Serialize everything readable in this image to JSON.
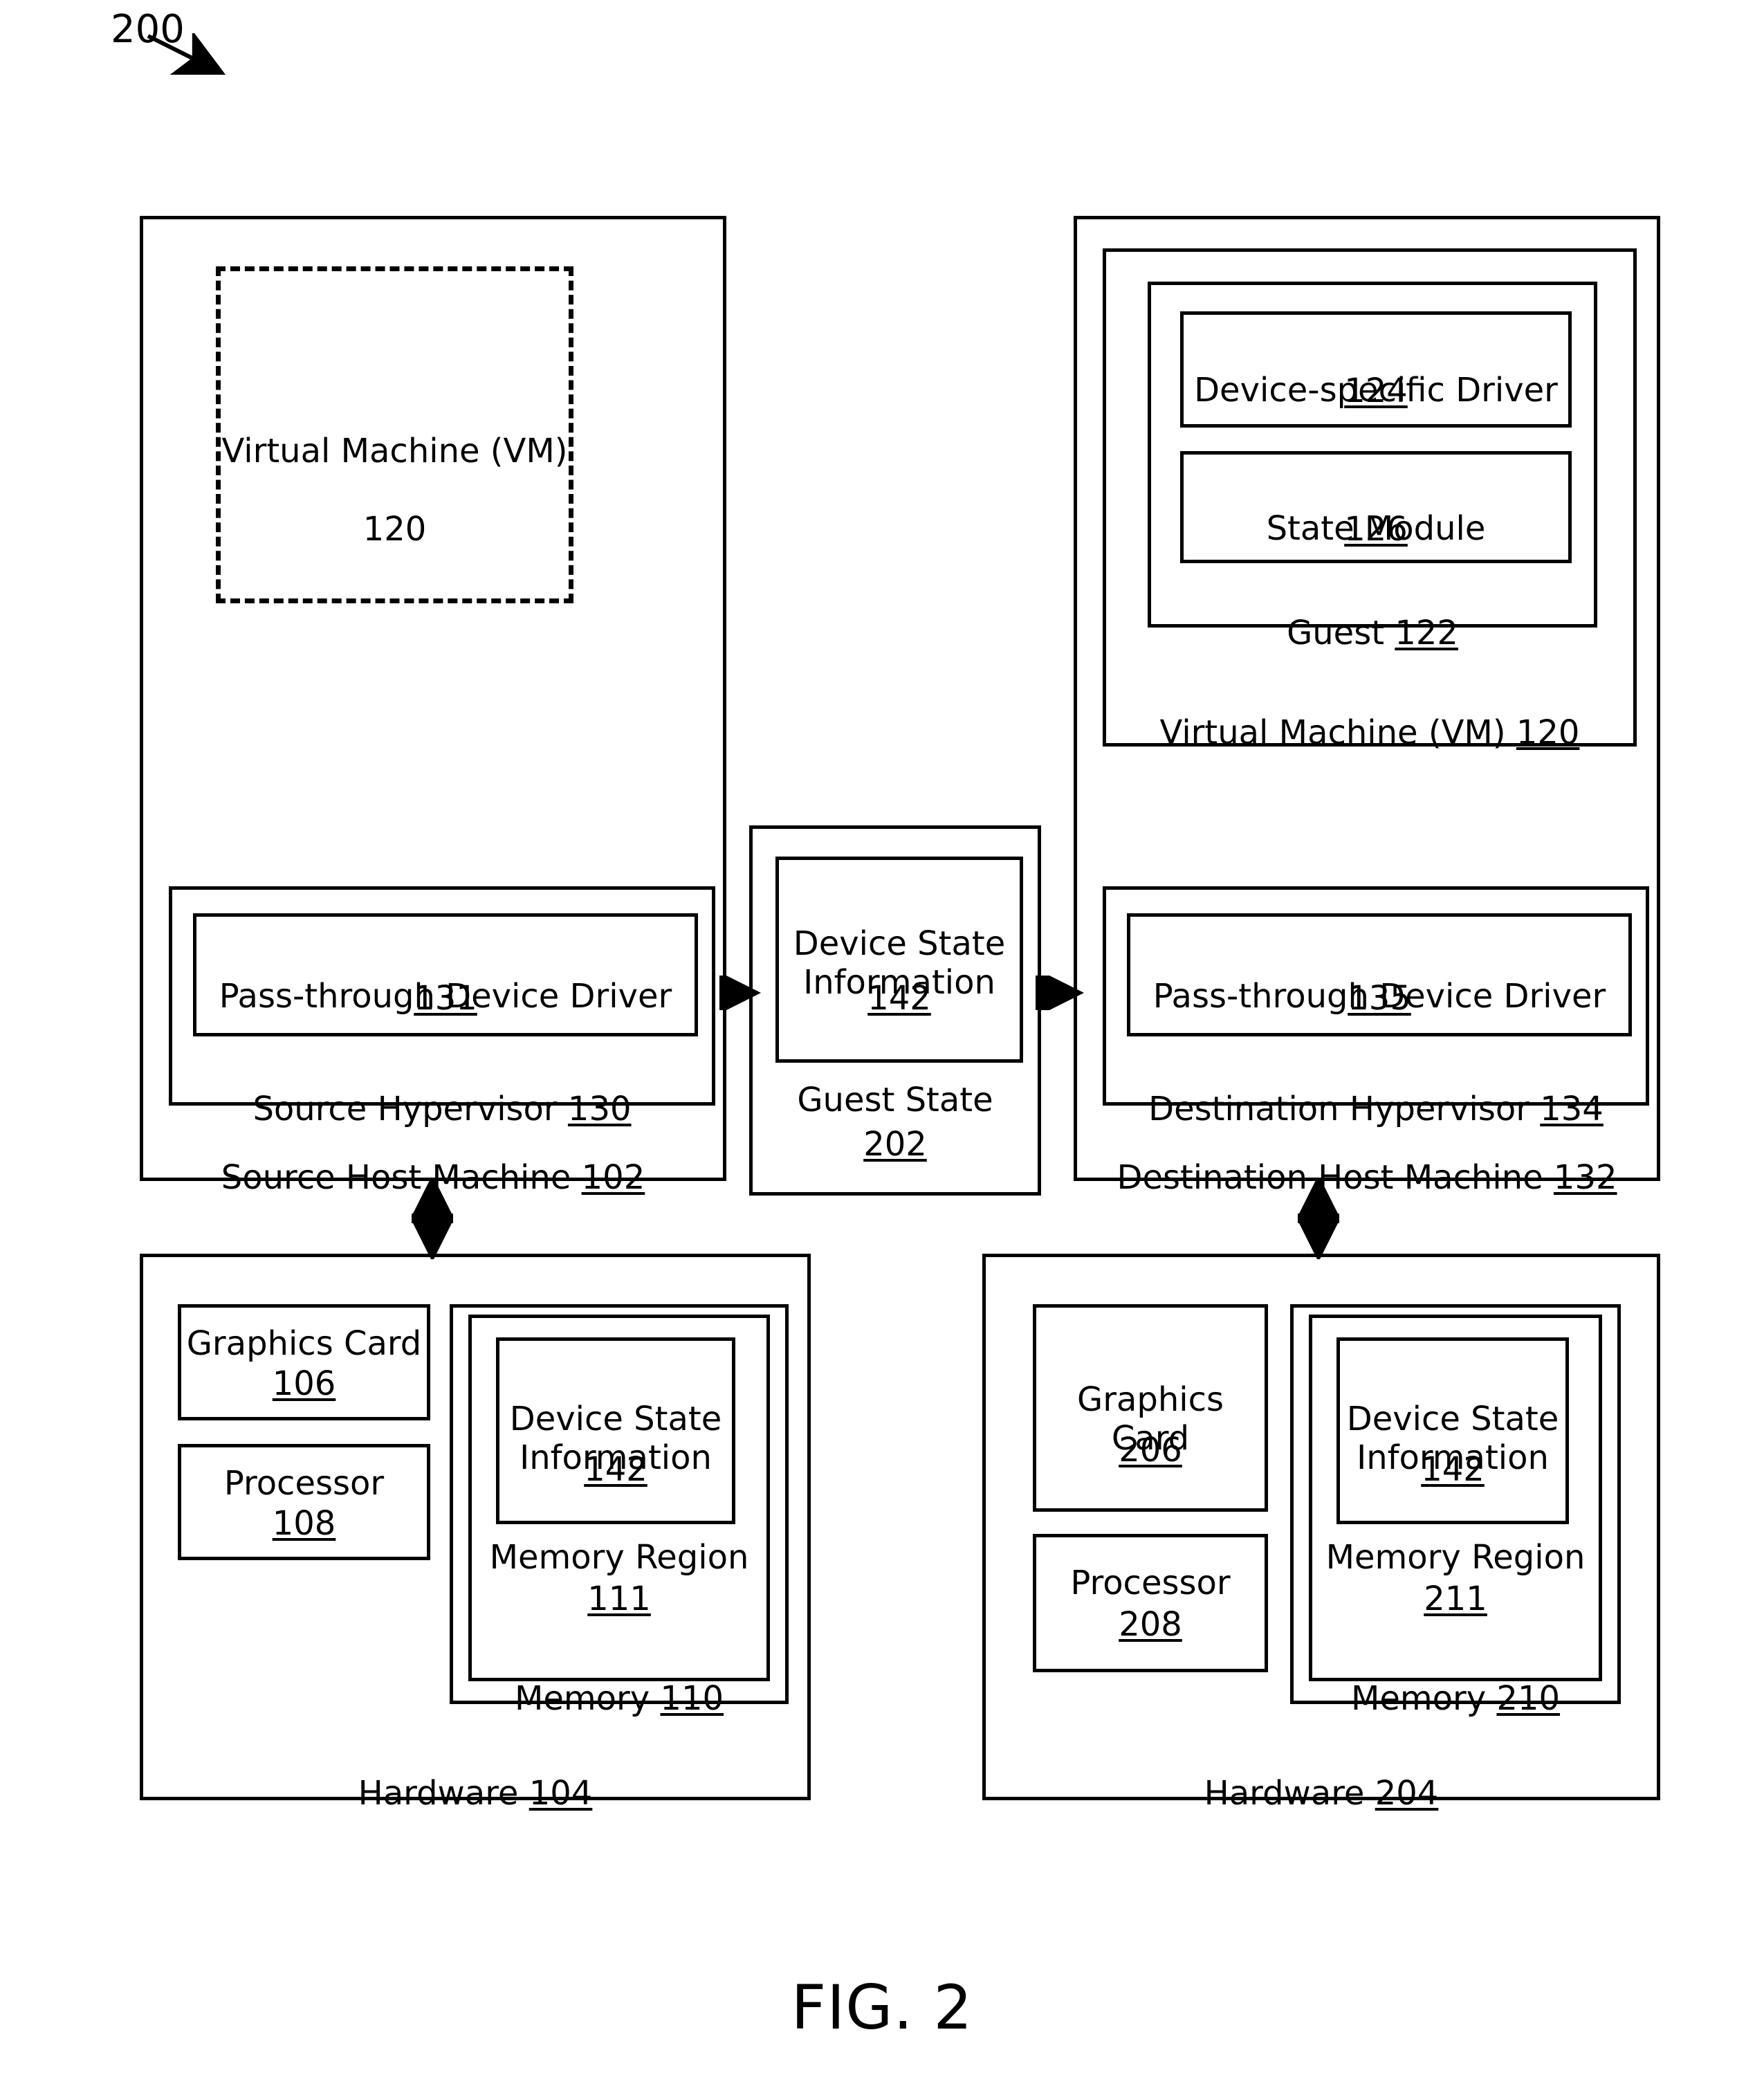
{
  "figure": {
    "number": "200",
    "caption": "FIG. 2"
  },
  "source_host": {
    "label": "Source Host Machine",
    "ref": "102",
    "vm": {
      "label": "Virtual Machine (VM)",
      "ref": "120"
    },
    "hypervisor": {
      "label": "Source Hypervisor",
      "ref": "130",
      "driver": {
        "label": "Pass-through Device Driver",
        "ref": "131"
      }
    }
  },
  "guest_state": {
    "label": "Guest State",
    "ref": "202",
    "device_state": {
      "label": "Device State Information",
      "ref": "142"
    }
  },
  "destination_host": {
    "label": "Destination Host Machine",
    "ref": "132",
    "vm": {
      "label": "Virtual Machine (VM)",
      "ref": "120",
      "guest": {
        "label": "Guest",
        "ref": "122",
        "device_driver": {
          "label": "Device-specific Driver",
          "ref": "124"
        },
        "state_module": {
          "label": "State Module",
          "ref": "126"
        }
      }
    },
    "hypervisor": {
      "label": "Destination Hypervisor",
      "ref": "134",
      "driver": {
        "label": "Pass-through Device Driver",
        "ref": "135"
      }
    }
  },
  "source_hardware": {
    "label": "Hardware",
    "ref": "104",
    "graphics_card": {
      "label": "Graphics Card",
      "ref": "106"
    },
    "processor": {
      "label": "Processor",
      "ref": "108"
    },
    "memory": {
      "label": "Memory",
      "ref": "110"
    },
    "memory_region": {
      "label": "Memory Region",
      "ref": "111"
    },
    "device_state": {
      "label": "Device State Information",
      "ref": "142"
    }
  },
  "destination_hardware": {
    "label": "Hardware",
    "ref": "204",
    "graphics_card": {
      "label": "Graphics Card",
      "ref": "206"
    },
    "processor": {
      "label": "Processor",
      "ref": "208"
    },
    "memory": {
      "label": "Memory",
      "ref": "210"
    },
    "memory_region": {
      "label": "Memory Region",
      "ref": "211"
    },
    "device_state": {
      "label": "Device State Information",
      "ref": "142"
    }
  },
  "colors": {
    "stroke": "#000000",
    "background": "#ffffff"
  }
}
